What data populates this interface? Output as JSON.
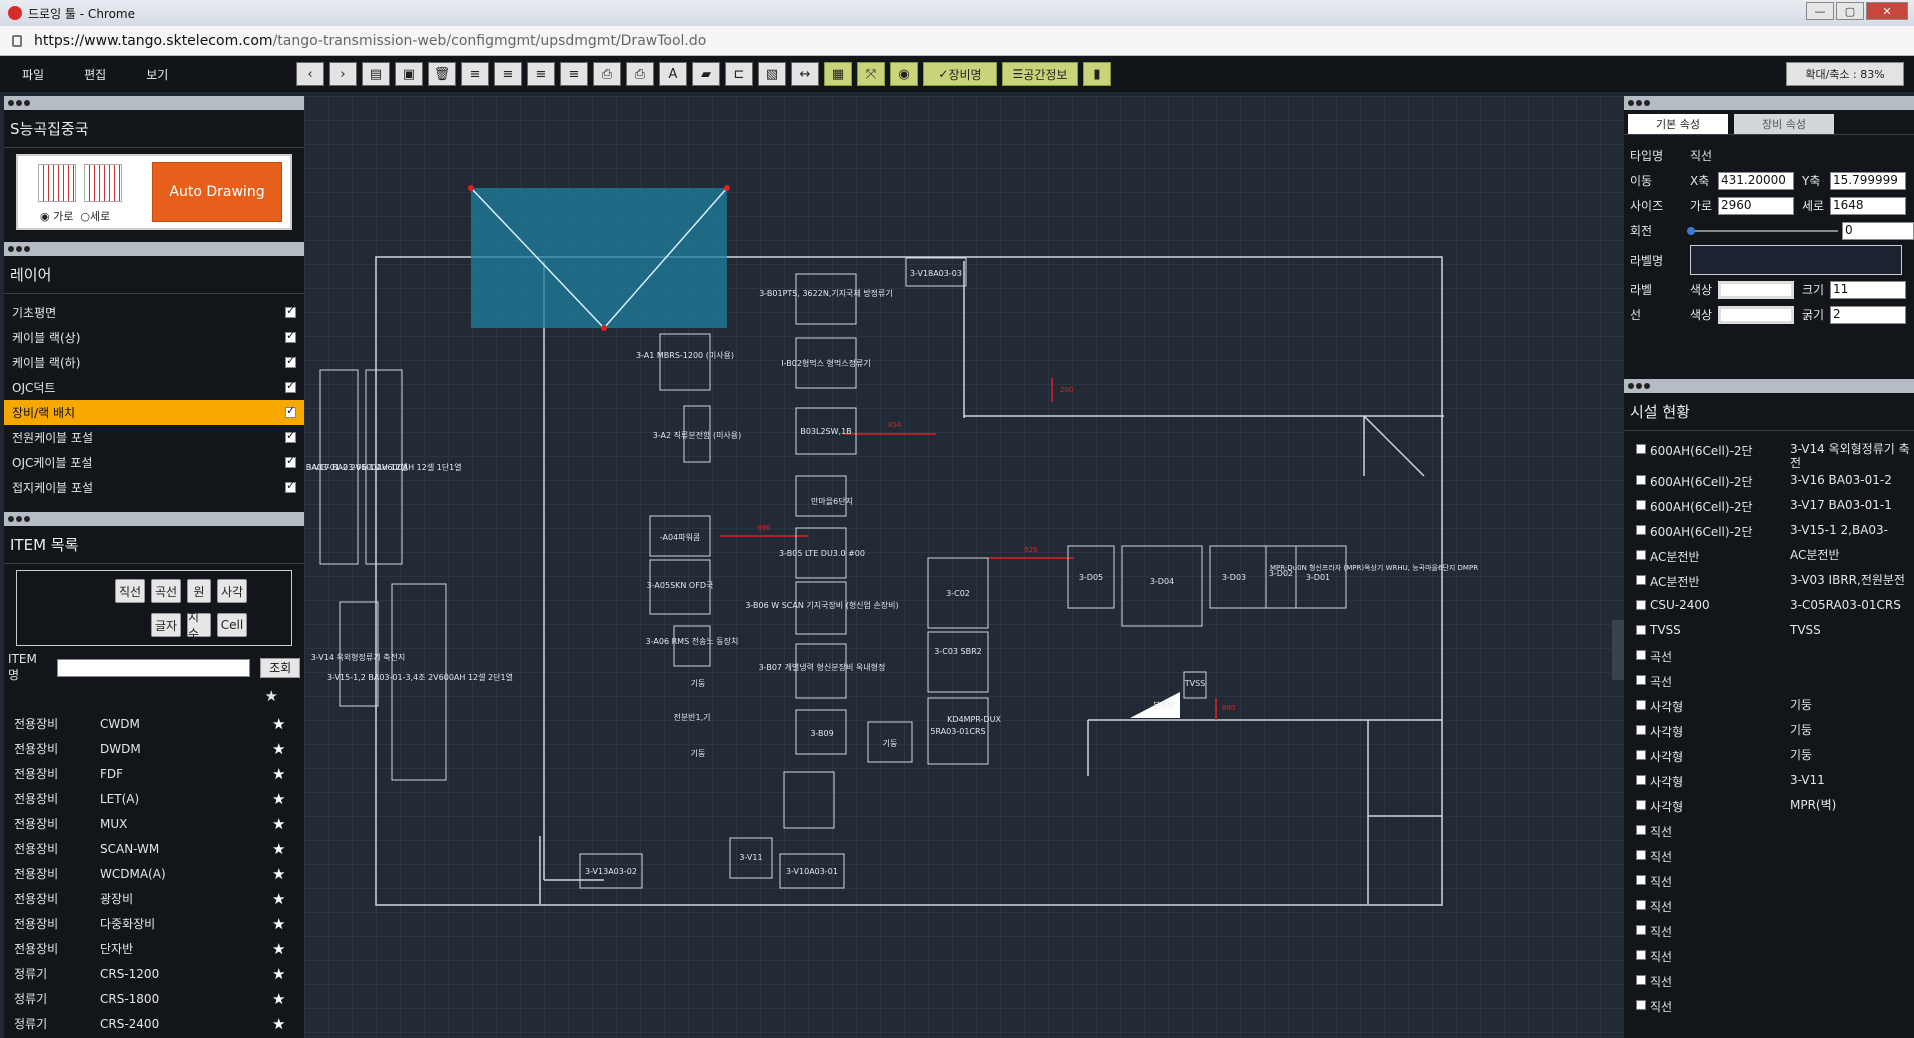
{
  "window": {
    "title": "드로잉 툴 - Chrome",
    "url_host": "https://www.tango.sktelecom.com",
    "url_path": "/tango-transmission-web/configmgmt/upsdmgmt/DrawTool.do"
  },
  "menu": [
    "파일",
    "편집",
    "보기"
  ],
  "toolbar": {
    "equip_label": "장비명",
    "space_label": "공간정보",
    "zoom_label": "확대/축소 : 83%"
  },
  "left": {
    "title": "S능곡집중국",
    "radio_h": "가로",
    "radio_v": "세로",
    "auto_drawing": "Auto Drawing",
    "layer_title": "레이어",
    "layers": [
      "기초평면",
      "케이블 랙(상)",
      "케이블 랙(하)",
      "OJC덕트",
      "장비/랙 배치",
      "전원케이블 포설",
      "OJC케이블 포설",
      "접지케이블 포설"
    ],
    "item_title": "ITEM 목록",
    "item_buttons": [
      "직선",
      "곡선",
      "원",
      "사각",
      "글자",
      "치수",
      "Cell"
    ],
    "item_name_label": "ITEM 명",
    "search_label": "조회",
    "items": [
      [
        "전용장비",
        "CWDM"
      ],
      [
        "전용장비",
        "DWDM"
      ],
      [
        "전용장비",
        "FDF"
      ],
      [
        "전용장비",
        "LET(A)"
      ],
      [
        "전용장비",
        "MUX"
      ],
      [
        "전용장비",
        "SCAN-WM"
      ],
      [
        "전용장비",
        "WCDMA(A)"
      ],
      [
        "전용장비",
        "광장비"
      ],
      [
        "전용장비",
        "다중화장비"
      ],
      [
        "전용장비",
        "단자반"
      ],
      [
        "정류기",
        "CRS-1200"
      ],
      [
        "정류기",
        "CRS-1800"
      ],
      [
        "정류기",
        "CRS-2400"
      ]
    ]
  },
  "right": {
    "tab_basic": "기본 속성",
    "tab_equip": "장비 속성",
    "type_label": "타입명",
    "type_value": "직선",
    "move_label": "이동",
    "x_label": "X축",
    "x_value": "431.20000",
    "y_label": "Y축",
    "y_value": "15.799999",
    "size_label": "사이즈",
    "w_label": "가로",
    "w_value": "2960",
    "h_label": "세로",
    "h_value": "1648",
    "rotate_label": "회전",
    "rotate_value": "0",
    "labelname_label": "라벨명",
    "label_label": "라벨",
    "color_label": "색상",
    "font_label": "크기",
    "font_value": "11",
    "line_label": "선",
    "line_color_label": "색상",
    "thick_label": "굵기",
    "thick_value": "2",
    "facility_title": "시설 현황",
    "facilities": [
      [
        "600AH(6Cell)-2단",
        "3-V14 옥외형정류기 축전"
      ],
      [
        "600AH(6Cell)-2단",
        "3-V16 BA03-01-2"
      ],
      [
        "600AH(6Cell)-2단",
        "3-V17 BA03-01-1"
      ],
      [
        "600AH(6Cell)-2단",
        "3-V15-1 2,BA03-"
      ],
      [
        "AC분전반",
        "AC분전반"
      ],
      [
        "AC분전반",
        "3-V03 IBRR,전원분전"
      ],
      [
        "CSU-2400",
        "3-C05RA03-01CRS"
      ],
      [
        "TVSS",
        "TVSS"
      ],
      [
        "곡선",
        ""
      ],
      [
        "곡선",
        ""
      ],
      [
        "사각형",
        "기둥"
      ],
      [
        "사각형",
        "기둥"
      ],
      [
        "사각형",
        "기둥"
      ],
      [
        "사각형",
        "3-V11"
      ],
      [
        "사각형",
        "MPR(벽)"
      ],
      [
        "직선",
        ""
      ],
      [
        "직선",
        ""
      ],
      [
        "직선",
        ""
      ],
      [
        "직선",
        ""
      ],
      [
        "직선",
        ""
      ],
      [
        "직선",
        ""
      ],
      [
        "직선",
        ""
      ],
      [
        "직선",
        ""
      ]
    ]
  },
  "canvas": {
    "equipment": [
      "3-V18A03-03",
      "3-B01PTS, 3622N,기지국제 방정류기",
      "3-A1 MBRS-1200 (미사용)",
      "I-B02형먹스 형먹스정류기",
      "3-A2 직류분전함 (미사용)",
      "B03L2SW,1B",
      "만마을6단지",
      "-A04파워콤",
      "3-B05 LTE DU3.0 #00",
      "3-A05SKN OFD국",
      "3-B06 W SCAN 기지국장비 (형신업 손장비)",
      "3-A06 RMS 전송노 동장치",
      "3-B07 개별냉력 형신분장비 옥내형정",
      "3-B09",
      "3-V16 BA03-01-2 2V600AH 12셀",
      "3-V17 BA03-01-1 2V600AH 12셀 1단1열",
      "3-V14 옥외형정류기 축전지",
      "3-V15-1,2 BA03-01-3,4조 2V600AH 12셀 2단1열",
      "3-C02",
      "3-C03 SBR2",
      "3-D05",
      "3-D04",
      "3-D03",
      "3-D02",
      "3-D01",
      "MPR-Du0N 형신프라자 (MPR)옥상기 WRHU, 능곡마을6단지 DMPR",
      "TVSS",
      "분전반",
      "기둥",
      "기둥",
      "기둥",
      "5RA03-01CRS",
      "3-V13A03-02",
      "3-V11",
      "3-V10A03-01",
      "전분반1,기",
      "KD4MPR-DUX"
    ],
    "dims": [
      "854",
      "996",
      "929",
      "200",
      "880"
    ]
  },
  "colors": {
    "selection": "#1e7f9e",
    "dim": "#e02020",
    "accent": "#f6a800",
    "auto_btn": "#e7601b"
  }
}
